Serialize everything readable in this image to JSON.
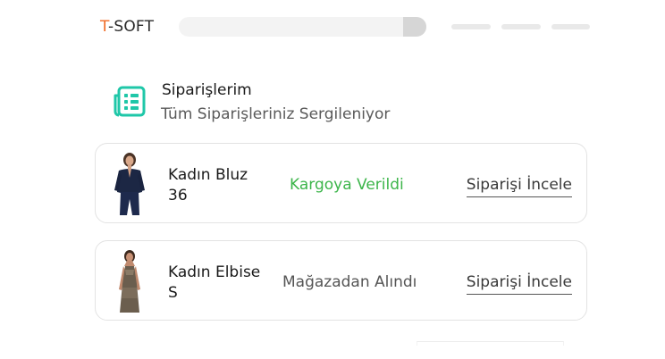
{
  "header": {
    "logo_accent": "T",
    "logo_rest": "-SOFT"
  },
  "page": {
    "title": "Siparişlerim",
    "subtitle": "Tüm Siparişleriniz Sergileniyor"
  },
  "orders": [
    {
      "product": "Kadın Bluz",
      "size": "36",
      "status": "Kargoya Verildi",
      "status_color": "#3cb54a",
      "action": "Siparişi İncele"
    },
    {
      "product": "Kadın Elbise",
      "size": "S",
      "status": "Mağazadan Alındı",
      "status_color": "#555555",
      "action": "Siparişi İncele"
    }
  ],
  "colors": {
    "brand_orange": "#f06a24",
    "icon_teal": "#1fc7a8"
  }
}
